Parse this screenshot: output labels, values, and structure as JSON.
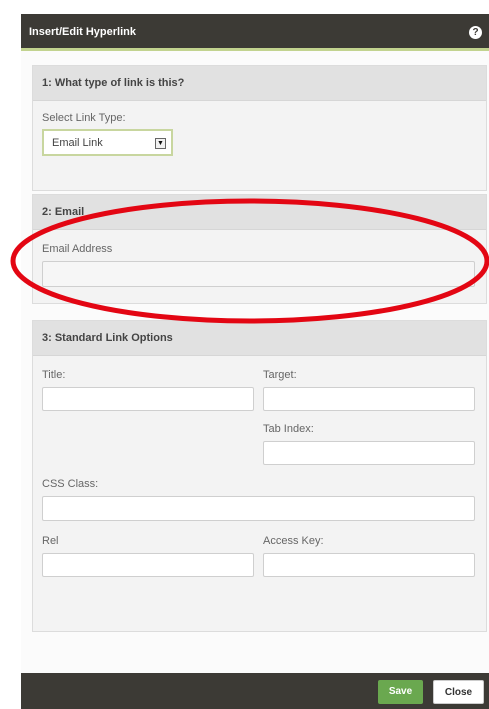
{
  "dialog": {
    "title": "Insert/Edit Hyperlink",
    "help_symbol": "?"
  },
  "section1": {
    "heading": "1: What type of link is this?",
    "select_label": "Select Link Type:",
    "select_value": "Email Link"
  },
  "section2": {
    "heading": "2: Email",
    "email_label": "Email Address",
    "email_value": ""
  },
  "section3": {
    "heading": "3: Standard Link Options",
    "title_label": "Title:",
    "target_label": "Target:",
    "tab_index_label": "Tab Index:",
    "css_class_label": "CSS Class:",
    "rel_label": "Rel",
    "access_key_label": "Access Key:"
  },
  "footer": {
    "save_label": "Save",
    "close_label": "Close"
  },
  "colors": {
    "titlebar": "#3c3a35",
    "accent_underline": "#c2d38f",
    "save_button": "#6aa84f",
    "annotation": "#e30613"
  }
}
